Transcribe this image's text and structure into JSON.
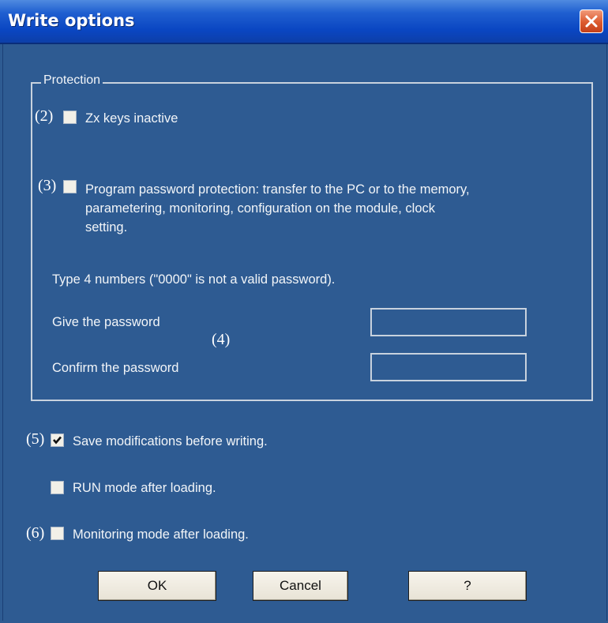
{
  "window": {
    "title": "Write options",
    "close_icon": "close-icon"
  },
  "protection": {
    "legend": "Protection",
    "zx_keys": {
      "annotation": "(2)",
      "label": "Zx keys inactive",
      "checked": false
    },
    "password_protection": {
      "annotation": "(3)",
      "line1": "Program password protection: transfer to the PC or to the memory,",
      "line2": "parametering, monitoring, configuration on the module, clock",
      "line3": "setting.",
      "checked": false
    },
    "hint": "Type 4 numbers (\"0000\" is not a valid password).",
    "password_annotation": "(4)",
    "give_password": {
      "label": "Give the password",
      "value": ""
    },
    "confirm_password": {
      "label": "Confirm the password",
      "value": ""
    }
  },
  "options": {
    "save_modifications": {
      "annotation": "(5)",
      "label": "Save modifications before writing.",
      "checked": true
    },
    "run_mode": {
      "label": "RUN mode after loading.",
      "checked": false
    },
    "monitoring_mode": {
      "annotation": "(6)",
      "label": "Monitoring mode after loading.",
      "checked": false
    }
  },
  "buttons": {
    "ok": "OK",
    "cancel": "Cancel",
    "help": "?"
  },
  "colors": {
    "titlebar": "#0a46c2",
    "dialog_background": "#2e5b92",
    "close_button": "#dc5a2e",
    "text": "#f2f5f8"
  }
}
